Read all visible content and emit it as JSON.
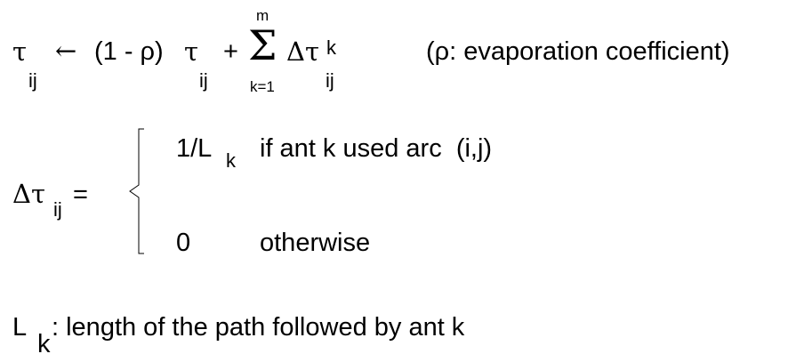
{
  "update_rule": {
    "tau": "τ",
    "tau_sub": "ij",
    "arrow": "←",
    "factor": "(1 - ρ)",
    "tau2": "τ",
    "tau2_sub": "ij",
    "plus": "+",
    "sigma": "Σ",
    "sigma_upper": "m",
    "sigma_lower": "k=1",
    "delta_tau": "Δτ",
    "delta_sup": "k",
    "delta_sub": "ij",
    "note": "(ρ: evaporation coefficient)"
  },
  "delta_definition": {
    "lhs": "Δτ",
    "lhs_sub": "ij",
    "equals": "=",
    "case1_value": "1/L",
    "case1_sub": "k",
    "case1_condition": "if ant k used arc  (i,j)",
    "case2_value": "0",
    "case2_condition": "otherwise"
  },
  "length_definition": {
    "symbol": "L",
    "sub": "k",
    "text": ": length of the path followed by ant k"
  }
}
